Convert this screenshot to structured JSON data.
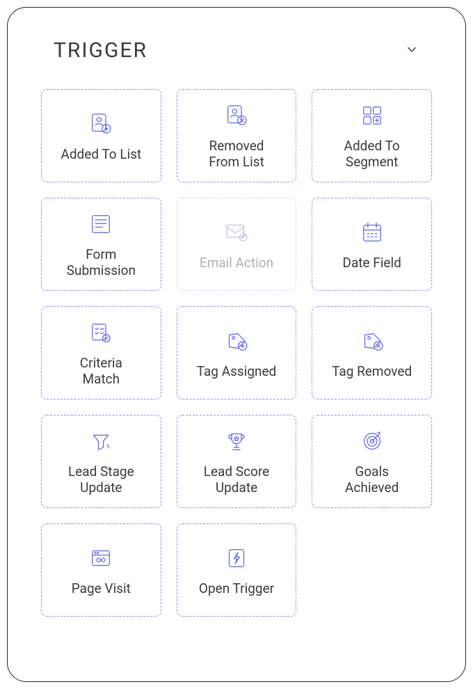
{
  "header": {
    "title": "TRIGGER"
  },
  "tiles": [
    {
      "label": "Added To List",
      "icon": "list-add",
      "disabled": false
    },
    {
      "label": "Removed\nFrom List",
      "icon": "list-remove",
      "disabled": false
    },
    {
      "label": "Added To\nSegment",
      "icon": "segment-add",
      "disabled": false
    },
    {
      "label": "Form\nSubmission",
      "icon": "form",
      "disabled": false
    },
    {
      "label": "Email Action",
      "icon": "email",
      "disabled": true
    },
    {
      "label": "Date Field",
      "icon": "calendar",
      "disabled": false
    },
    {
      "label": "Criteria\nMatch",
      "icon": "criteria",
      "disabled": false
    },
    {
      "label": "Tag Assigned",
      "icon": "tag-add",
      "disabled": false
    },
    {
      "label": "Tag Removed",
      "icon": "tag-remove",
      "disabled": false
    },
    {
      "label": "Lead Stage\nUpdate",
      "icon": "funnel",
      "disabled": false
    },
    {
      "label": "Lead Score\nUpdate",
      "icon": "trophy",
      "disabled": false
    },
    {
      "label": "Goals\nAchieved",
      "icon": "target",
      "disabled": false
    },
    {
      "label": "Page Visit",
      "icon": "browser",
      "disabled": false
    },
    {
      "label": "Open Trigger",
      "icon": "bolt",
      "disabled": false
    }
  ]
}
